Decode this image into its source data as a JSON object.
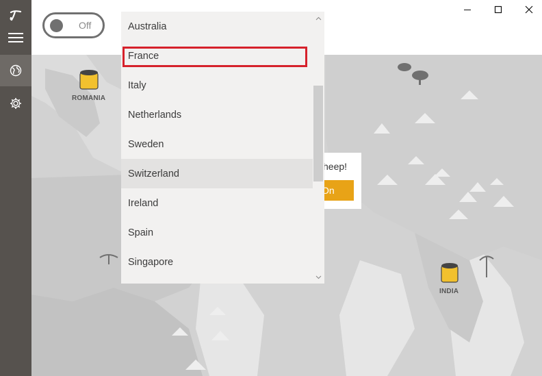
{
  "app": {
    "title": "TunnelBear"
  },
  "toggle": {
    "state_label": "Off"
  },
  "sidebar": {
    "items": [
      {
        "icon": "tunnelbear-logo-icon"
      },
      {
        "icon": "hamburger-menu-icon"
      },
      {
        "icon": "globe-icon"
      },
      {
        "icon": "gear-icon"
      }
    ]
  },
  "window_controls": {
    "minimize": "minimize-icon",
    "maximize": "maximize-icon",
    "close": "close-icon"
  },
  "map": {
    "markers": [
      {
        "label": "ROMANIA"
      },
      {
        "label": "INDIA"
      }
    ]
  },
  "popup": {
    "text_fragment": "heep!",
    "button_fragment": "On"
  },
  "country_dropdown": {
    "items": [
      {
        "label": "Australia"
      },
      {
        "label": "France"
      },
      {
        "label": "Italy"
      },
      {
        "label": "Netherlands"
      },
      {
        "label": "Sweden"
      },
      {
        "label": "Switzerland"
      },
      {
        "label": "Ireland"
      },
      {
        "label": "Spain"
      },
      {
        "label": "Singapore"
      }
    ],
    "hovered": "Switzerland",
    "highlighted": "France"
  },
  "colors": {
    "sidebar": "#56524e",
    "accent": "#e8a317",
    "highlight_border": "#d6212b",
    "dropdown_bg": "#f2f1f0"
  }
}
